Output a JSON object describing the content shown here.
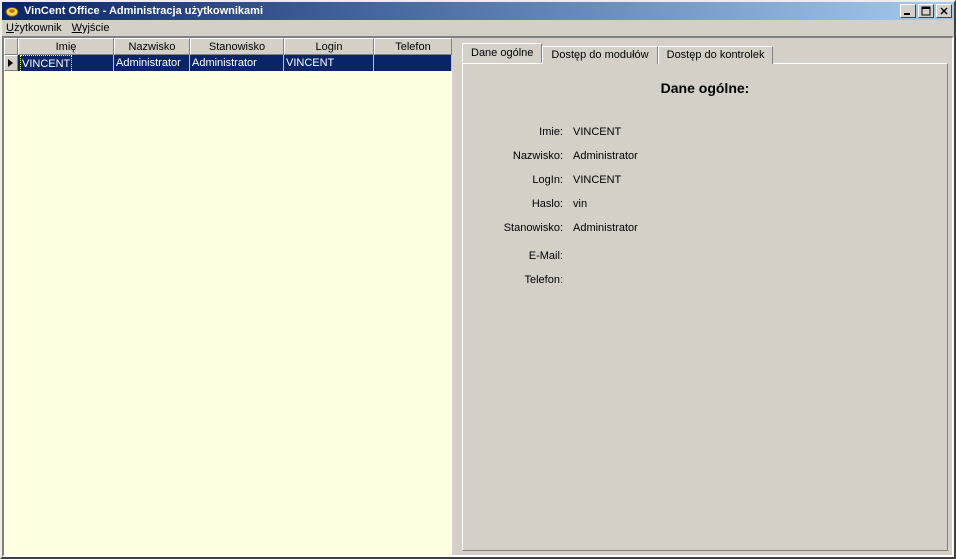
{
  "window": {
    "title": "VinCent Office - Administracja użytkownikami"
  },
  "menu": {
    "user_prefix": "U",
    "user_rest": "żytkownik",
    "exit_prefix": "W",
    "exit_rest": "yjście"
  },
  "grid": {
    "headers": {
      "imie": "Imię",
      "nazwisko": "Nazwisko",
      "stanowisko": "Stanowisko",
      "login": "Login",
      "telefon": "Telefon"
    },
    "rows": [
      {
        "imie": "VINCENT",
        "nazwisko": "Administrator",
        "stanowisko": "Administrator",
        "login": "VINCENT",
        "telefon": ""
      }
    ]
  },
  "tabs": {
    "general": "Dane ogólne",
    "modules": "Dostęp do modułów",
    "controls": "Dostęp do kontrolek"
  },
  "details": {
    "title": "Dane ogólne:",
    "labels": {
      "imie": "Imie:",
      "nazwisko": "Nazwisko:",
      "login": "LogIn:",
      "haslo": "Haslo:",
      "stanowisko": "Stanowisko:",
      "email": "E-Mail:",
      "telefon": "Telefon:"
    },
    "values": {
      "imie": "VINCENT",
      "nazwisko": "Administrator",
      "login": "VINCENT",
      "haslo": "vin",
      "stanowisko": "Administrator",
      "email": "",
      "telefon": ""
    }
  }
}
